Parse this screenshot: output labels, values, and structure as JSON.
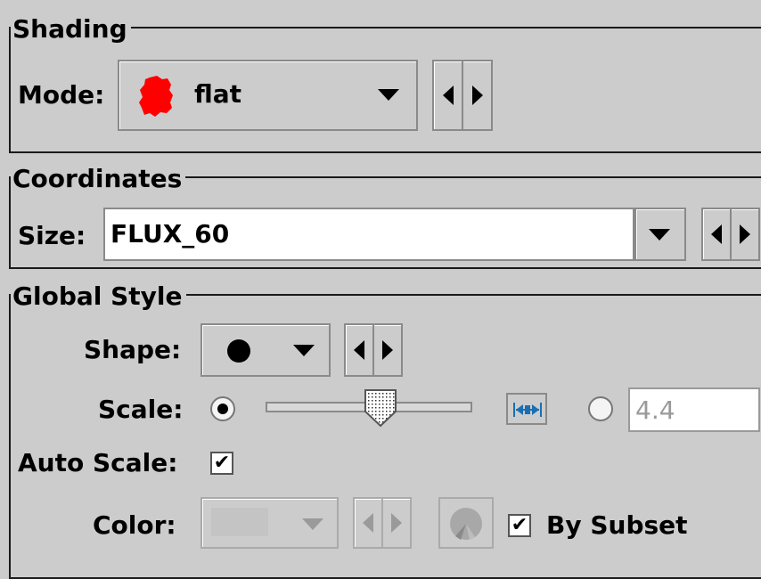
{
  "shading": {
    "legend": "Shading",
    "mode_label": "Mode:",
    "mode_value": "flat",
    "mode_icon": "red-blob-icon",
    "mode_icon_color": "#ff0000"
  },
  "coordinates": {
    "legend": "Coordinates",
    "size_label": "Size:",
    "size_value": "FLUX_60"
  },
  "global_style": {
    "legend": "Global Style",
    "shape_label": "Shape:",
    "shape_value_icon": "filled-circle-icon",
    "scale_label": "Scale:",
    "scale_slider_fraction": 0.55,
    "scale_text_value": "4.4",
    "scale_mode_selected": "slider",
    "auto_scale_label": "Auto Scale:",
    "auto_scale_checked": true,
    "color_label": "Color:",
    "color_enabled": false,
    "by_subset_label": "By Subset",
    "by_subset_checked": true
  },
  "colors": {
    "background": "#cccccc",
    "accent_blue": "#1a6fb0",
    "disabled": "#9a9a9a"
  }
}
